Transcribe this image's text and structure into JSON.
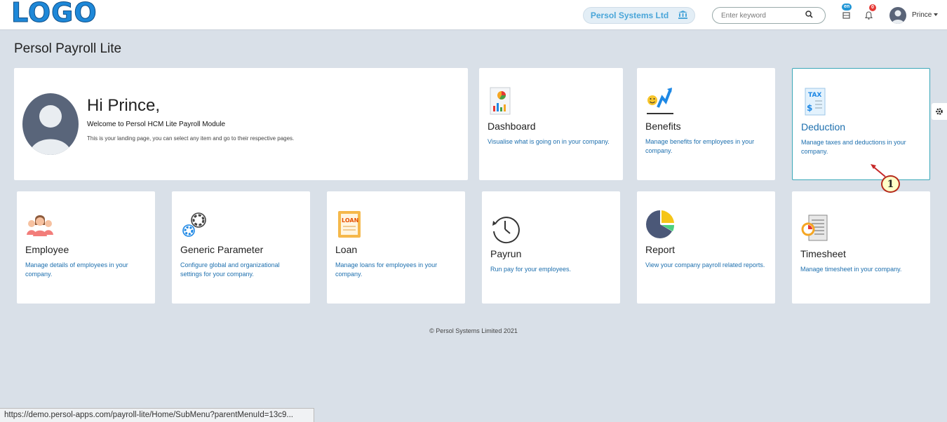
{
  "header": {
    "logo": "LOGO",
    "company": "Persol Systems Ltd",
    "search_placeholder": "Enter keyword",
    "lang_badge": "en",
    "notif_count": "0",
    "user_name": "Prince"
  },
  "page_title": "Persol Payroll Lite",
  "welcome": {
    "greeting": "Hi Prince,",
    "line1": "Welcome to Persol HCM Lite Payroll Module",
    "line2": "This is your landing page, you can select any item and go to their respective pages."
  },
  "cards": [
    {
      "title": "Dashboard",
      "desc": "Visualise what is going on in your company."
    },
    {
      "title": "Benefits",
      "desc": "Manage benefits for employees in your company."
    },
    {
      "title": "Deduction",
      "desc": "Manage taxes and deductions in your company."
    },
    {
      "title": "Employee",
      "desc": "Manage details of employees in your company."
    },
    {
      "title": "Generic Parameter",
      "desc": "Configure global and organizational settings for your company."
    },
    {
      "title": "Loan",
      "desc": "Manage loans for employees in your company."
    },
    {
      "title": "Payrun",
      "desc": "Run pay for your employees."
    },
    {
      "title": "Report",
      "desc": "View your company payroll related reports."
    },
    {
      "title": "Timesheet",
      "desc": "Manage timesheet in your company."
    }
  ],
  "icon_text": {
    "tax": "TAX",
    "loan": "LOAN"
  },
  "callout_number": "1",
  "footer": "© Persol Systems Limited 2021",
  "status_url": "https://demo.persol-apps.com/payroll-lite/Home/SubMenu?parentMenuId=13c9...",
  "colors": {
    "accent": "#1d6fae",
    "selected_border": "#3aa7b8",
    "background": "#d9e0e8"
  }
}
